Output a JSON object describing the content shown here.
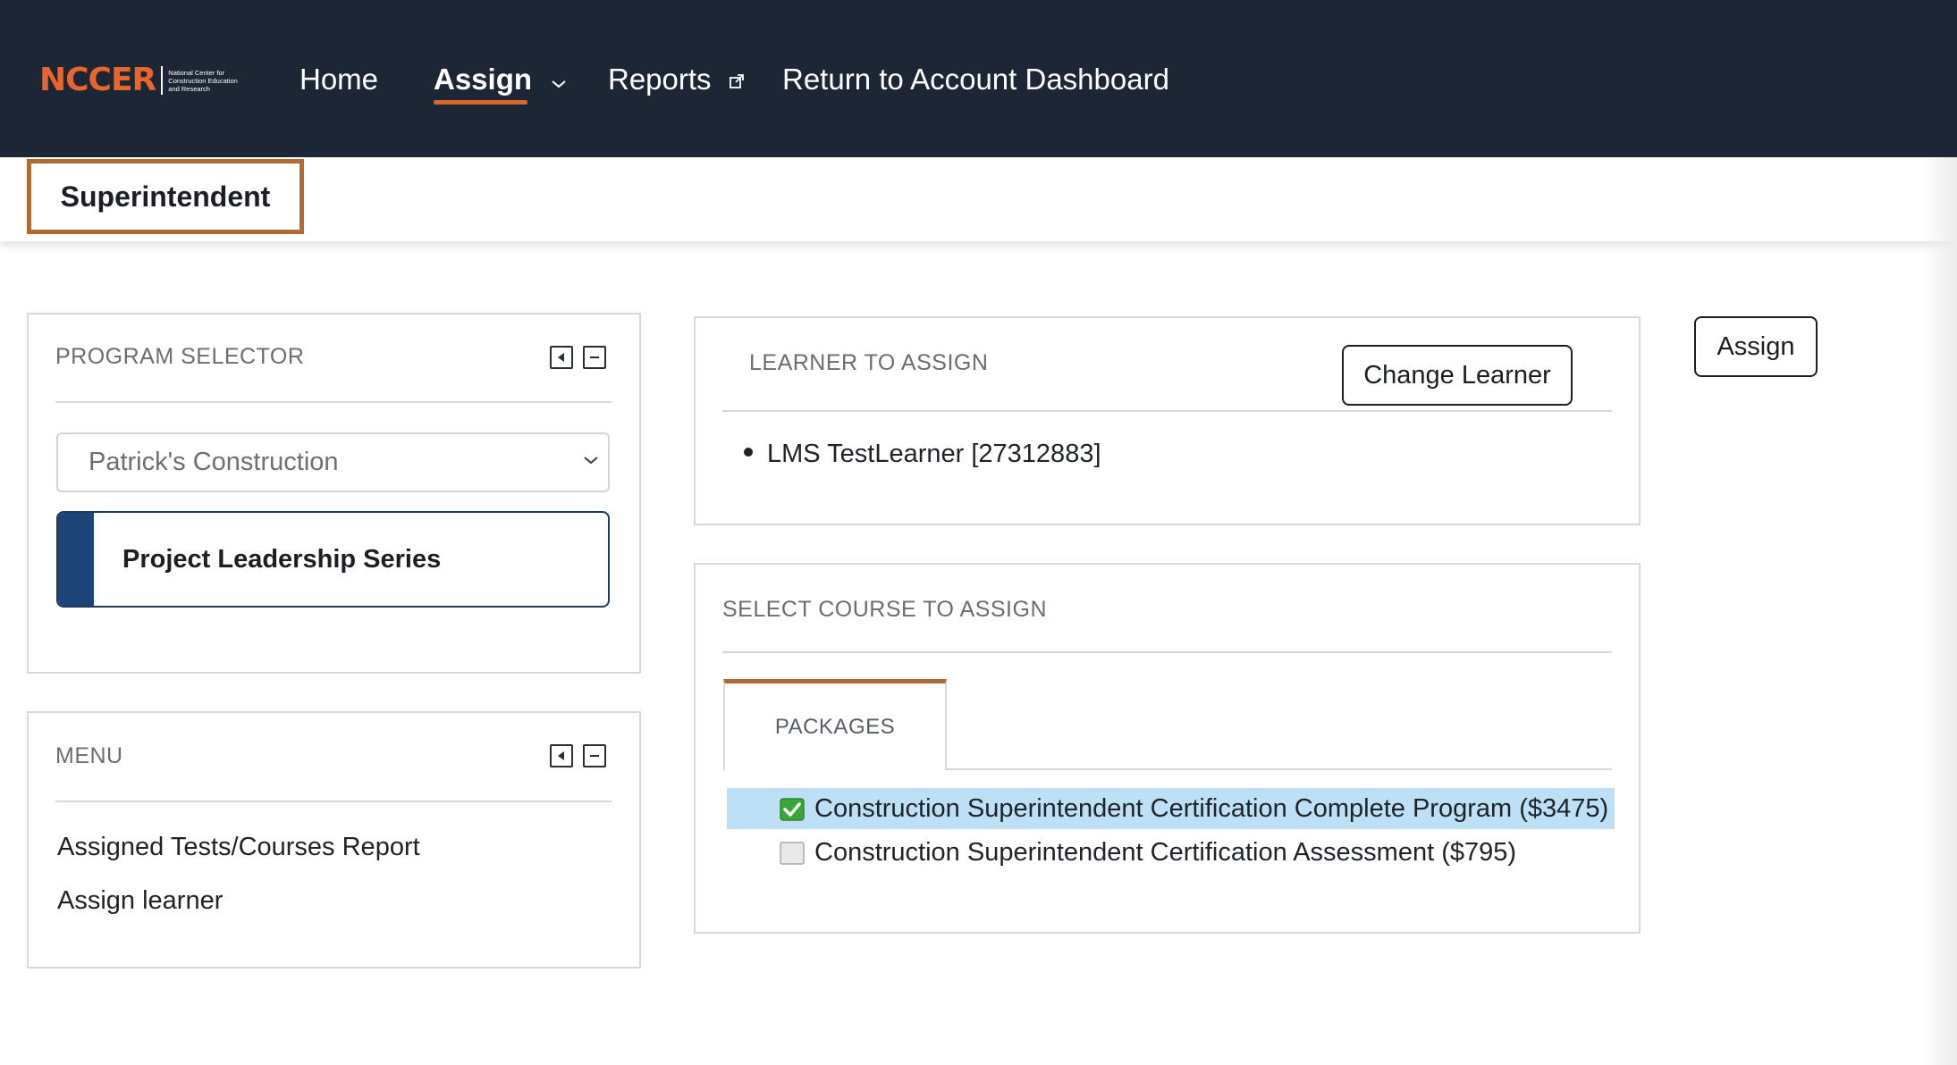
{
  "logo": {
    "word": "NCCER",
    "tagline": [
      "National Center for",
      "Construction Education",
      "and Research"
    ]
  },
  "nav": {
    "home": "Home",
    "assign": "Assign",
    "reports": "Reports",
    "dashboard": "Return to Account Dashboard"
  },
  "role_tab": "Superintendent",
  "program_selector": {
    "title": "PROGRAM SELECTOR",
    "selected_company": "Patrick's Construction",
    "program": "Project Leadership Series"
  },
  "menu": {
    "title": "MENU",
    "items": [
      "Assigned Tests/Courses Report",
      "Assign learner"
    ]
  },
  "learner": {
    "title": "LEARNER TO ASSIGN",
    "change_button": "Change Learner",
    "name": "LMS TestLearner [27312883]"
  },
  "assign_button": "Assign",
  "course": {
    "title": "SELECT COURSE TO ASSIGN",
    "tab": "PACKAGES",
    "packages": [
      {
        "label": "Construction Superintendent Certification Complete Program ($3475)",
        "checked": true
      },
      {
        "label": "Construction Superintendent Certification Assessment ($795)",
        "checked": false
      }
    ]
  },
  "colors": {
    "nav_bg": "#1c2635",
    "accent": "#b06a33",
    "program_accent": "#1c4478",
    "selected_row": "#bde0f7",
    "check_green": "#3aa53a"
  },
  "icons": {
    "assign_dropdown": "chevron-down-icon",
    "reports_external": "external-link-icon",
    "panel_collapse": "caret-left-icon",
    "panel_minimize": "minus-icon",
    "select_dropdown": "chevron-down-icon",
    "checked": "checkbox-checked-icon",
    "unchecked": "checkbox-unchecked-icon"
  }
}
